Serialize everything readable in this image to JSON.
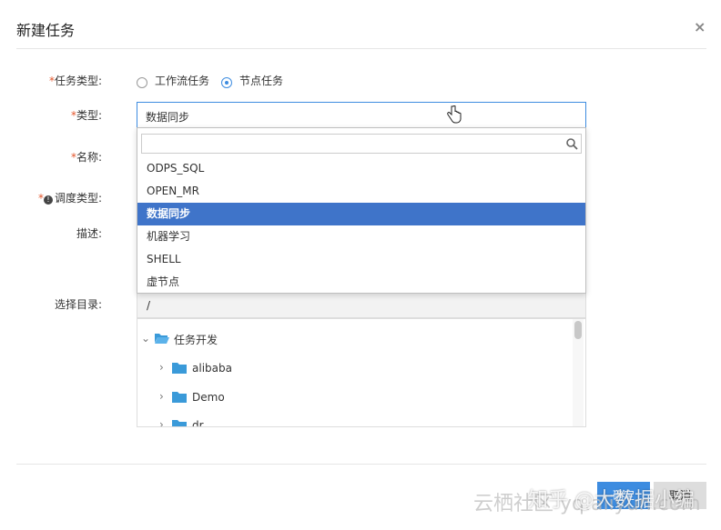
{
  "dialog": {
    "title": "新建任务",
    "close_glyph": "×"
  },
  "form": {
    "required_mark": "*",
    "task_type": {
      "label": "任务类型:",
      "options": [
        "工作流任务",
        "节点任务"
      ],
      "selected": "节点任务"
    },
    "type": {
      "label": "类型:",
      "value": "数据同步"
    },
    "name": {
      "label": "名称:"
    },
    "schedule_type": {
      "label": "调度类型:"
    },
    "description": {
      "label": "描述:"
    },
    "directory": {
      "label": "选择目录:",
      "value": "/"
    }
  },
  "dropdown": {
    "search_placeholder": "",
    "items": [
      "ODPS_SQL",
      "OPEN_MR",
      "数据同步",
      "机器学习",
      "SHELL",
      "虚节点"
    ],
    "selected_index": 2
  },
  "tree": {
    "root": "任务开发",
    "children": [
      "alibaba",
      "Demo",
      "dr"
    ]
  },
  "footer": {
    "ok_label": "确定",
    "cancel_label": "取消"
  },
  "watermark": {
    "text": "云栖社区 yq.aliyun.com",
    "overlay": "知乎 @大数据小编"
  },
  "colors": {
    "accent": "#3d8ce0",
    "selected_bg": "#3f74c9",
    "required": "#e3552b",
    "folder": "#3a9ad9"
  }
}
